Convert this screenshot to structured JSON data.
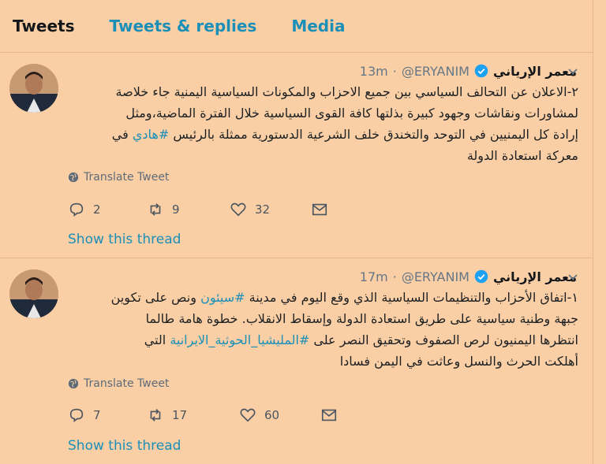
{
  "tabs": [
    {
      "label": "Tweets"
    },
    {
      "label": "Tweets & replies"
    },
    {
      "label": "Media"
    }
  ],
  "tweets": [
    {
      "name": "معمر الإرياني",
      "handle": "@ERYANIM",
      "time": "13m",
      "body_lines": [
        "٢-الاعلان عن التحالف السياسي بين جميع الاحزاب والمكونات السياسية اليمنية جاء خلاصة",
        "لمشاورات ونقاشات وجهود كبيرة بذلتها كافة القوى السياسية خلال الفترة الماضية،ومثل",
        "إرادة كل اليمنيين في التوحد والتخندق خلف الشرعية الدستورية ممثلة بالرئيس",
        "معركة استعادة الدولة"
      ],
      "hashtag": "#هادي",
      "after_hashtag": "في",
      "translate": "Translate Tweet",
      "replies": "2",
      "retweets": "9",
      "likes": "32",
      "thread": "Show this thread"
    },
    {
      "name": "معمر الإرياني",
      "handle": "@ERYANIM",
      "time": "17m",
      "line1_pre": "١-اتفاق الأحزاب والتنظيمات السياسية الذي وقع اليوم في مدينة",
      "hashtag1": "#سيئون",
      "line1_post": "ونص على تكوين",
      "line2": "جبهة وطنية سياسية على طريق استعادة الدولة وإسقاط الانقلاب. خطوة هامة طالما",
      "line3_pre": "انتظرها اليمنيون لرص الصفوف وتحقيق النصر على",
      "hashtag2": "#المليشيا_الحوثية_الايرانية",
      "line3_post": "التي",
      "line4": "أهلكت الحرث والنسل وعاثت في اليمن فسادا",
      "translate": "Translate Tweet",
      "replies": "7",
      "retweets": "17",
      "likes": "60",
      "thread": "Show this thread"
    }
  ],
  "colors": {
    "background": "#fbcfa6",
    "link": "#1a8fb8",
    "verified": "#1da1f2"
  }
}
